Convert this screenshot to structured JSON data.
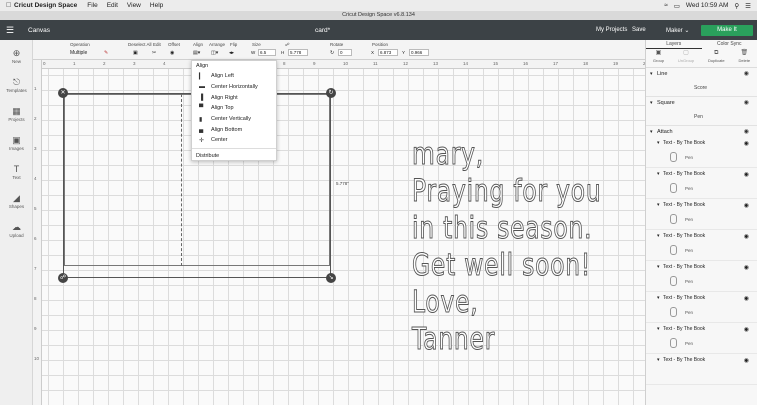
{
  "menubar": {
    "apple": "",
    "app_name": "Cricut Design Space",
    "items": [
      "File",
      "Edit",
      "View",
      "Help"
    ],
    "clock": "Wed 10:59 AM"
  },
  "window": {
    "title": "Cricut Design Space v6.8.134"
  },
  "header": {
    "section": "Canvas",
    "project_name": "card*",
    "my_projects": "My Projects",
    "save": "Save",
    "machine": "Maker",
    "make_it": "Make It"
  },
  "toolbar": {
    "operation_label": "Operation",
    "operation_value": "Multiple",
    "deselect_label": "Deselect All",
    "edit_label": "Edit",
    "offset_label": "Offset",
    "align_label": "Align",
    "arrange_label": "Arrange",
    "flip_label": "Flip",
    "size_label": "Size",
    "size_w_label": "W",
    "size_w": "6.5",
    "size_h_label": "H",
    "size_h": "5.778",
    "rotate_label": "Rotate",
    "rotate_value": "0",
    "position_label": "Position",
    "pos_x_label": "X",
    "pos_x": "6.873",
    "pos_y_label": "Y",
    "pos_y": "0.966"
  },
  "rail": {
    "items": [
      {
        "label": "New",
        "icon": "plus-icon"
      },
      {
        "label": "Templates",
        "icon": "shirt-icon"
      },
      {
        "label": "Projects",
        "icon": "projects-icon"
      },
      {
        "label": "Images",
        "icon": "images-icon"
      },
      {
        "label": "Text",
        "icon": "text-icon"
      },
      {
        "label": "Shapes",
        "icon": "shapes-icon"
      },
      {
        "label": "Upload",
        "icon": "upload-icon"
      }
    ]
  },
  "ruler": {
    "top": [
      "0",
      "1",
      "2",
      "3",
      "4",
      "5",
      "6",
      "7",
      "8",
      "9",
      "10",
      "11",
      "12",
      "13",
      "14",
      "15",
      "16",
      "17",
      "18",
      "19",
      "20",
      "21"
    ],
    "left": [
      "1",
      "2",
      "3",
      "4",
      "5",
      "6",
      "7",
      "8",
      "9",
      "10"
    ]
  },
  "canvas": {
    "width_label": "6.5\"",
    "height_label": "5.778\"",
    "text_lines": [
      "mary,",
      "Praying for you",
      "in this season.",
      "Get well soon!",
      "Love,",
      "Tanner"
    ]
  },
  "align_menu": {
    "title": "Align",
    "items": [
      {
        "label": "Align Left",
        "icon": "align-left-icon"
      },
      {
        "label": "Center Horizontally",
        "icon": "center-horizontal-icon"
      },
      {
        "label": "Align Right",
        "icon": "align-right-icon"
      },
      {
        "label": "Align Top",
        "icon": "align-top-icon"
      },
      {
        "label": "Center Vertically",
        "icon": "center-vertical-icon"
      },
      {
        "label": "Align Bottom",
        "icon": "align-bottom-icon"
      },
      {
        "label": "Center",
        "icon": "center-icon"
      }
    ],
    "distribute": "Distribute"
  },
  "panel": {
    "tabs": [
      "Layers",
      "Color Sync"
    ],
    "tools": [
      {
        "label": "Group",
        "icon": "group-icon"
      },
      {
        "label": "UnGroup",
        "icon": "ungroup-icon"
      },
      {
        "label": "Duplicate",
        "icon": "duplicate-icon"
      },
      {
        "label": "Delete",
        "icon": "delete-icon"
      }
    ],
    "line": {
      "name": "Line",
      "sub": "Score"
    },
    "square": {
      "name": "Square",
      "sub": "Pen"
    },
    "attach": "Attach",
    "text_layers": [
      {
        "name": "Text - By The Book",
        "sub": "Pen"
      },
      {
        "name": "Text - By The Book",
        "sub": "Pen"
      },
      {
        "name": "Text - By The Book",
        "sub": "Pen"
      },
      {
        "name": "Text - By The Book",
        "sub": "Pen"
      },
      {
        "name": "Text - By The Book",
        "sub": "Pen"
      },
      {
        "name": "Text - By The Book",
        "sub": "Pen"
      },
      {
        "name": "Text - By The Book",
        "sub": "Pen"
      },
      {
        "name": "Text - By The Book",
        "sub": "Pen"
      }
    ]
  }
}
